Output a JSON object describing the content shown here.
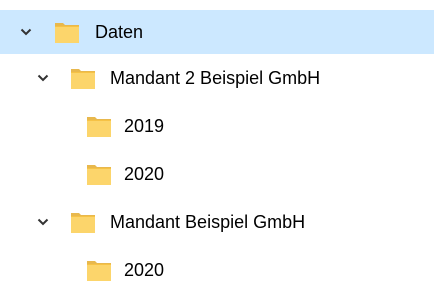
{
  "tree": {
    "root": {
      "label": "Daten",
      "expanded": true,
      "selected": true,
      "icon": "folder-icon",
      "expander_icon": "chevron-down-icon"
    },
    "clients": [
      {
        "label": "Mandant 2 Beispiel GmbH",
        "expanded": true,
        "icon": "folder-icon",
        "expander_icon": "chevron-down-icon",
        "children": [
          {
            "label": "2019",
            "icon": "folder-icon"
          },
          {
            "label": "2020",
            "icon": "folder-icon"
          }
        ]
      },
      {
        "label": "Mandant Beispiel GmbH",
        "expanded": true,
        "icon": "folder-icon",
        "expander_icon": "chevron-down-icon",
        "children": [
          {
            "label": "2020",
            "icon": "folder-icon"
          }
        ]
      }
    ]
  },
  "colors": {
    "selection_background": "#cce8ff",
    "folder_fill": "#fcd56b",
    "folder_tab": "#e8b84d",
    "chevron": "#333333",
    "text": "#000000"
  }
}
